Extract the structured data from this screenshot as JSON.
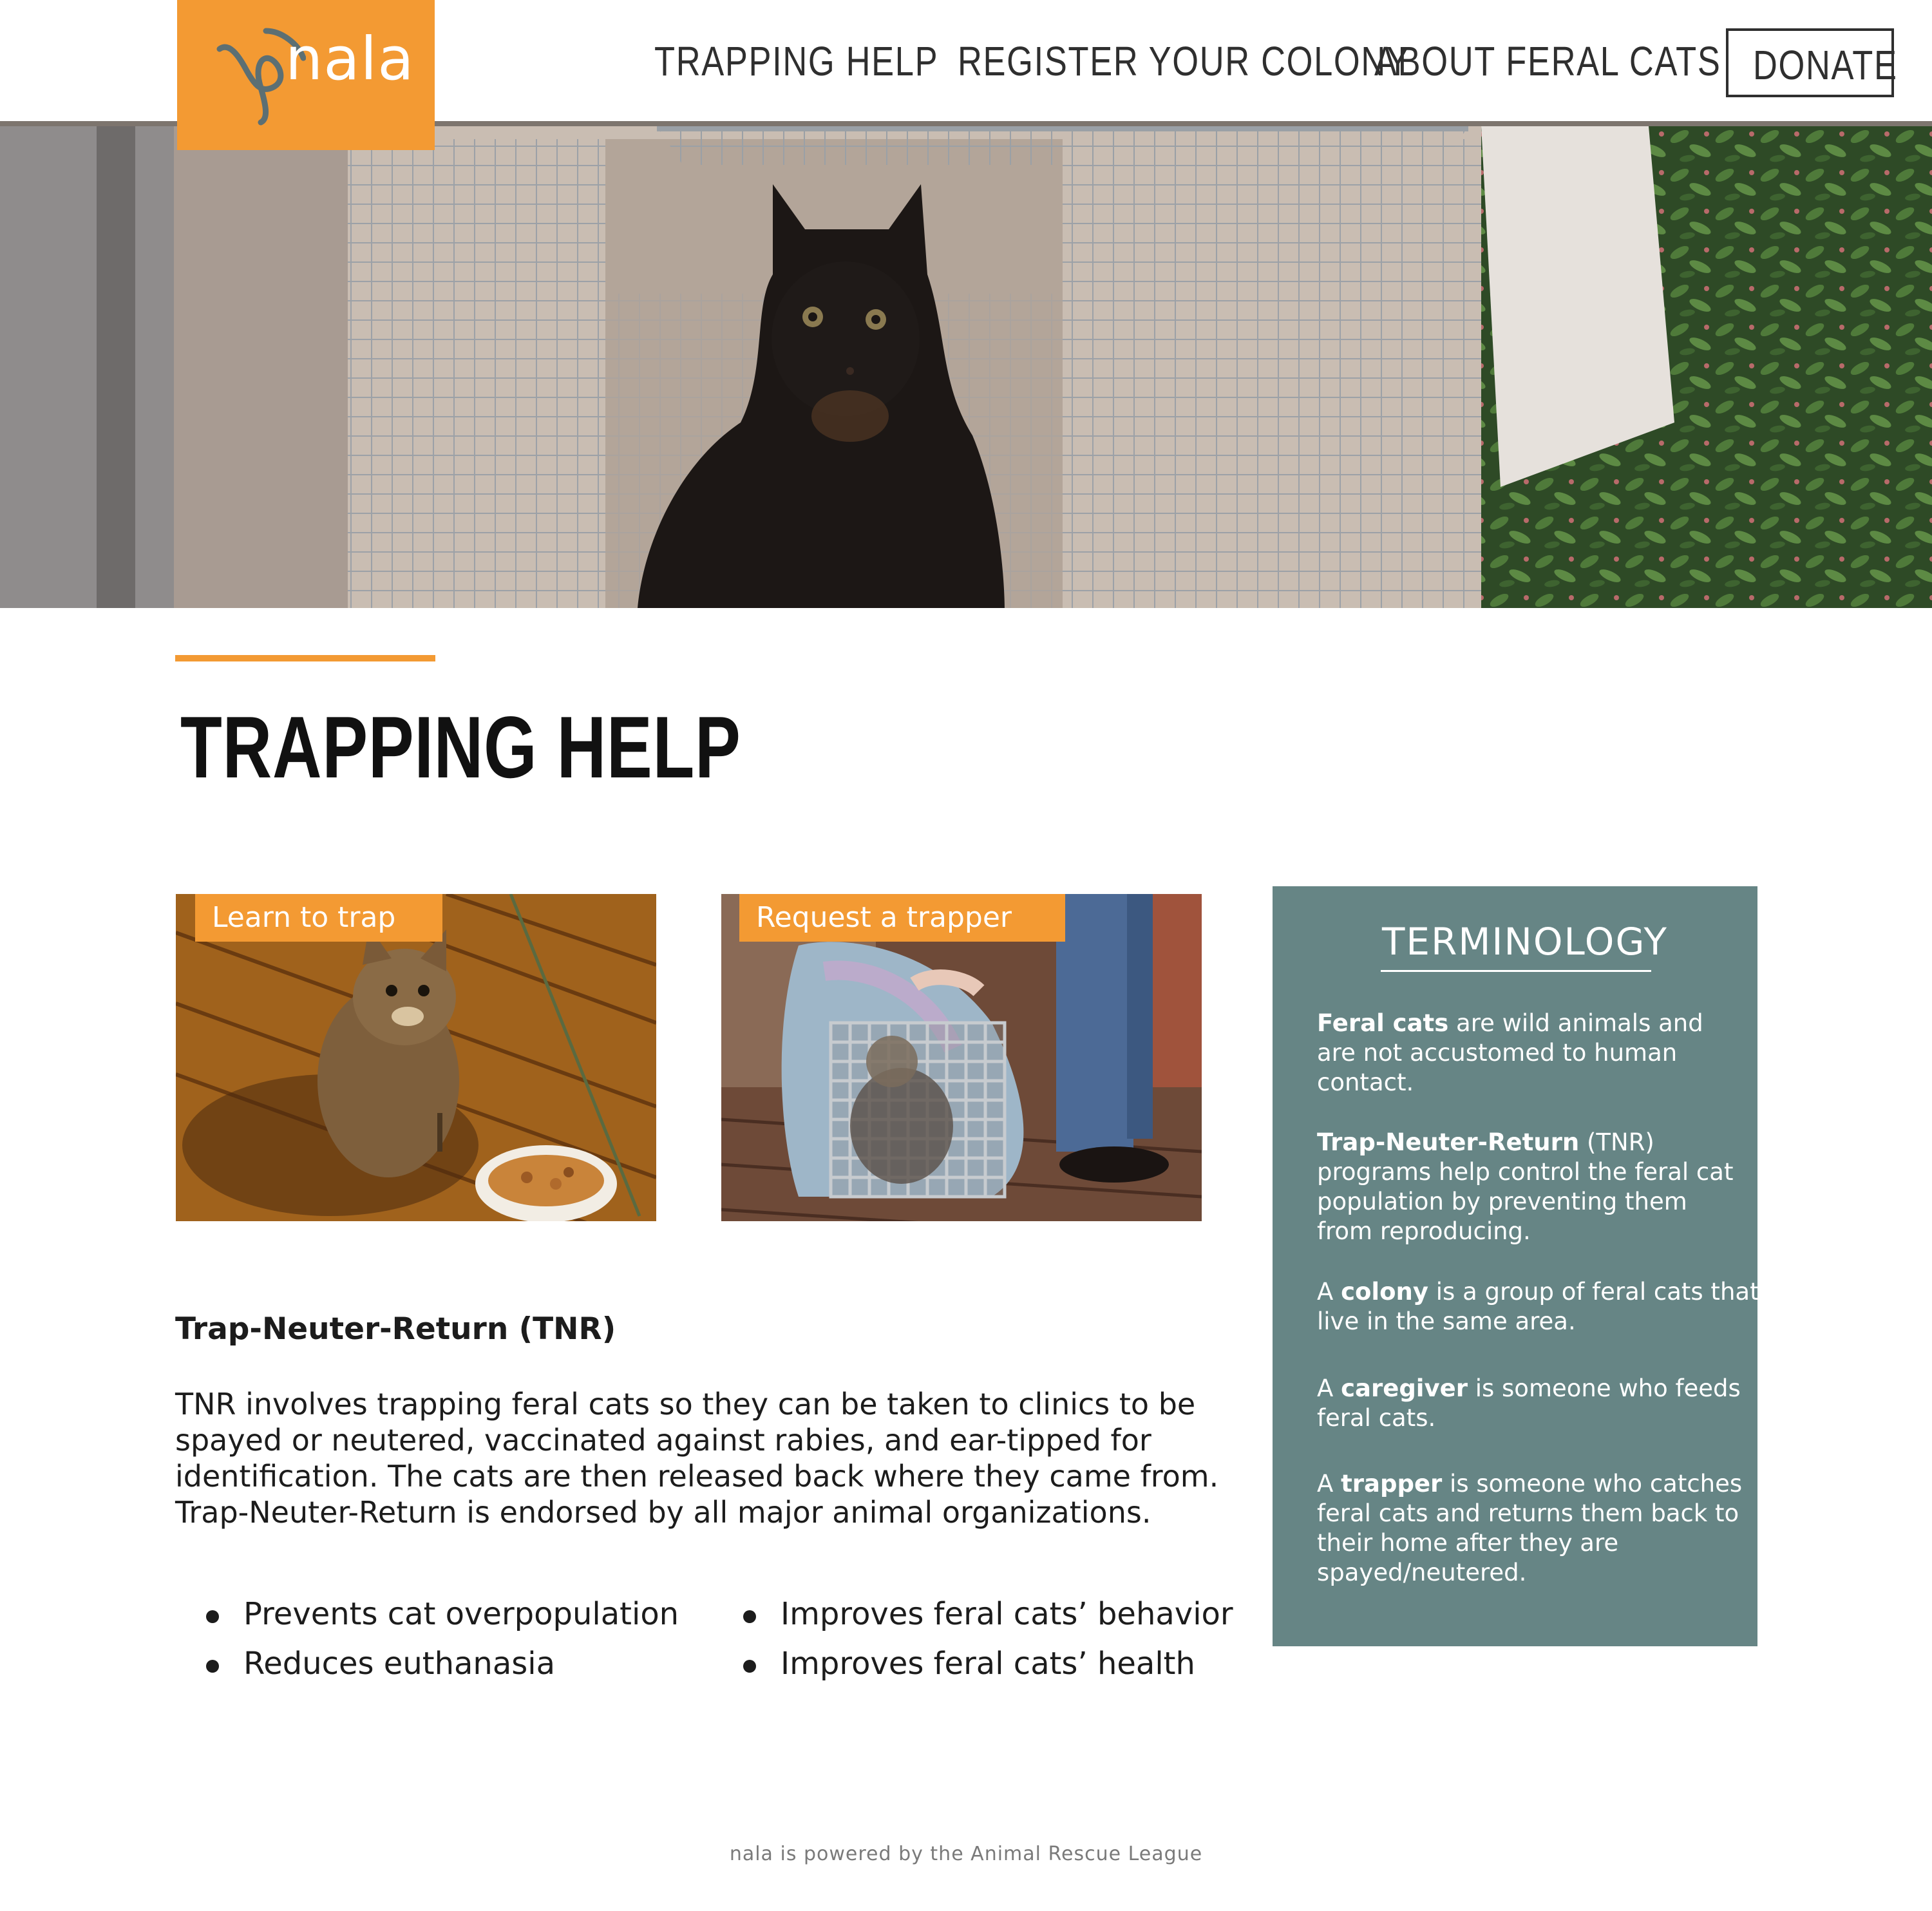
{
  "brand": {
    "name": "nala",
    "accent": "#f39a33",
    "panel_color": "#668585"
  },
  "nav": {
    "items": [
      {
        "label": "TRAPPING HELP"
      },
      {
        "label": "REGISTER YOUR COLONY"
      },
      {
        "label": "ABOUT FERAL CATS"
      }
    ],
    "donate_label": "DONATE"
  },
  "hero": {
    "image": "black-kitten-in-trap-photo"
  },
  "page": {
    "title": "TRAPPING HELP"
  },
  "cards": [
    {
      "tag": "Learn to trap",
      "image": "tabby-cat-with-food-bowl-photo"
    },
    {
      "tag": "Request a trapper",
      "image": "cat-in-wire-trap-photo"
    }
  ],
  "tnr": {
    "heading": "Trap-Neuter-Return (TNR)",
    "body_lines": [
      "TNR involves trapping feral cats so they can be taken to clinics to be",
      "spayed or neutered, vaccinated against rabies, and ear-tipped for",
      "identification. The cats are then released back where they came from.",
      "Trap-Neuter-Return is endorsed by all major animal organizations."
    ],
    "bullets_left": [
      "Prevents cat overpopulation",
      "Reduces euthanasia"
    ],
    "bullets_right": [
      "Improves feral cats’ behavior",
      "Improves feral cats’ health"
    ]
  },
  "terminology": {
    "title": "TERMINOLOGY",
    "terms": [
      {
        "lines": [
          [
            "",
            "Feral cats",
            " are wild animals and"
          ],
          [
            "are not accustomed to human"
          ],
          [
            "contact."
          ]
        ]
      },
      {
        "lines": [
          [
            "",
            "Trap-Neuter-Return",
            " (TNR)"
          ],
          [
            "programs help control the feral cat"
          ],
          [
            "population by preventing them"
          ],
          [
            "from reproducing."
          ]
        ]
      },
      {
        "lines": [
          [
            "A ",
            "colony",
            " is a group of feral cats that"
          ],
          [
            "live in the same area."
          ]
        ]
      },
      {
        "lines": [
          [
            "A ",
            "caregiver",
            " is someone who feeds"
          ],
          [
            "feral cats."
          ]
        ]
      },
      {
        "lines": [
          [
            "A ",
            "trapper",
            " is someone who catches"
          ],
          [
            "feral cats and returns them back to"
          ],
          [
            "their home after they are"
          ],
          [
            "spayed/neutered."
          ]
        ]
      }
    ]
  },
  "footer": {
    "text": "nala is powered by the Animal Rescue League"
  }
}
